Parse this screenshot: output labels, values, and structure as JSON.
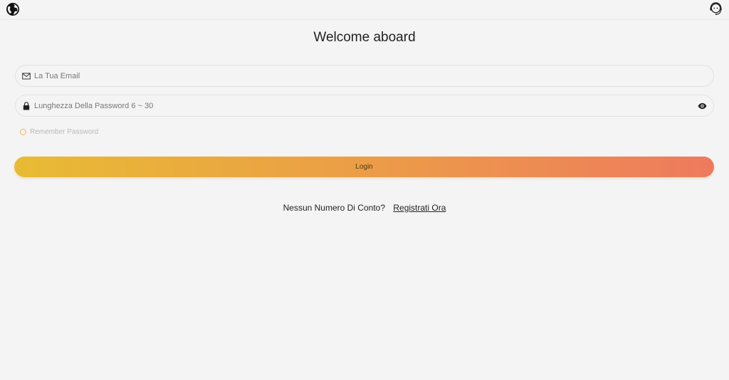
{
  "header": {
    "language_icon": "globe-icon",
    "support_icon": "customer-support-icon"
  },
  "title": "Welcome aboard",
  "form": {
    "email": {
      "placeholder": "La Tua Email",
      "value": "",
      "icon": "mail-icon"
    },
    "password": {
      "placeholder": "Lunghezza Della Password 6 ~ 30",
      "value": "",
      "icon": "lock-icon",
      "toggle_icon": "eye-icon"
    },
    "remember_label": "Remember Password",
    "remember_checked": false,
    "login_label": "Login"
  },
  "signup": {
    "prompt": "Nessun Numero Di Conto?",
    "link": "Registrati Ora"
  },
  "colors": {
    "background": "#f4f4f4",
    "gradient_start": "#e8bb34",
    "gradient_end": "#ee7a5e",
    "radio_border": "#f0b64a"
  }
}
